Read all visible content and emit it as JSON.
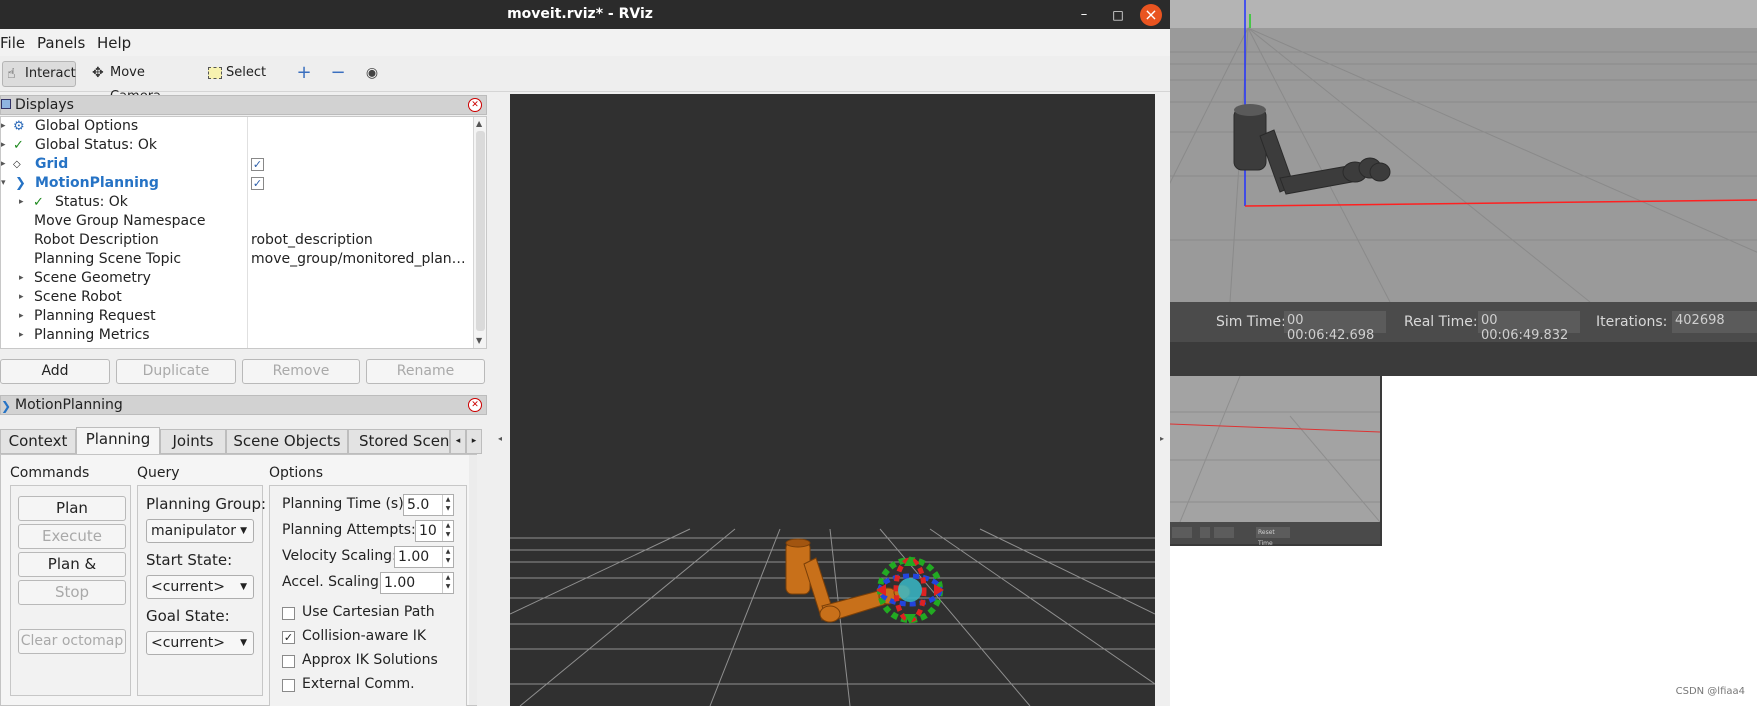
{
  "window": {
    "title": "moveit.rviz* - RViz",
    "minimize_glyph": "–",
    "maximize_glyph": "□",
    "close_glyph": "×"
  },
  "menu": {
    "file": "File",
    "panels": "Panels",
    "help": "Help"
  },
  "toolbar": {
    "interact": "Interact",
    "move_camera": "Move Camera",
    "select": "Select"
  },
  "displays": {
    "header": "Displays",
    "rows": [
      {
        "label": "Global Options",
        "value": ""
      },
      {
        "label": "Global Status: Ok",
        "value": ""
      },
      {
        "label": "Grid",
        "value": ""
      },
      {
        "label": "MotionPlanning",
        "value": ""
      },
      {
        "label": "Status: Ok",
        "value": ""
      },
      {
        "label": "Move Group Namespace",
        "value": ""
      },
      {
        "label": "Robot Description",
        "value": "robot_description"
      },
      {
        "label": "Planning Scene Topic",
        "value": "move_group/monitored_plan…"
      },
      {
        "label": "Scene Geometry",
        "value": ""
      },
      {
        "label": "Scene Robot",
        "value": ""
      },
      {
        "label": "Planning Request",
        "value": ""
      },
      {
        "label": "Planning Metrics",
        "value": ""
      }
    ],
    "buttons": {
      "add": "Add",
      "duplicate": "Duplicate",
      "remove": "Remove",
      "rename": "Rename"
    }
  },
  "motion_planning": {
    "header": "MotionPlanning",
    "tabs": [
      "Context",
      "Planning",
      "Joints",
      "Scene Objects",
      "Stored Scene"
    ],
    "active_tab": "Planning",
    "commands": {
      "title": "Commands",
      "plan": "Plan",
      "execute": "Execute",
      "plan_execute": "Plan & Execute",
      "stop": "Stop",
      "clear_octomap": "Clear octomap"
    },
    "query": {
      "title": "Query",
      "planning_group_label": "Planning Group:",
      "planning_group_value": "manipulator",
      "start_state_label": "Start State:",
      "start_state_value": "<current>",
      "goal_state_label": "Goal State:",
      "goal_state_value": "<current>"
    },
    "options": {
      "title": "Options",
      "planning_time_label": "Planning Time (s):",
      "planning_time_value": "5.0",
      "planning_attempts_label": "Planning Attempts:",
      "planning_attempts_value": "10",
      "velocity_scaling_label": "Velocity Scaling:",
      "velocity_scaling_value": "1.00",
      "accel_scaling_label": "Accel. Scaling:",
      "accel_scaling_value": "1.00",
      "use_cartesian_path": "Use Cartesian Path",
      "collision_aware_ik": "Collision-aware IK",
      "approx_ik_solutions": "Approx IK Solutions",
      "external_comm": "External Comm."
    }
  },
  "gazebo": {
    "sim_time_label": "Sim Time:",
    "sim_time_value": "00 00:06:42.698",
    "real_time_label": "Real Time:",
    "real_time_value": "00 00:06:49.832",
    "iterations_label": "Iterations:",
    "iterations_value": "402698",
    "mini_reset": "Reset Time"
  },
  "watermark": "CSDN @lfiaa4",
  "colors": {
    "robot_orange": "#c8701a",
    "selected_blue": "#2673c5",
    "ubuntu_close": "#e95420"
  }
}
